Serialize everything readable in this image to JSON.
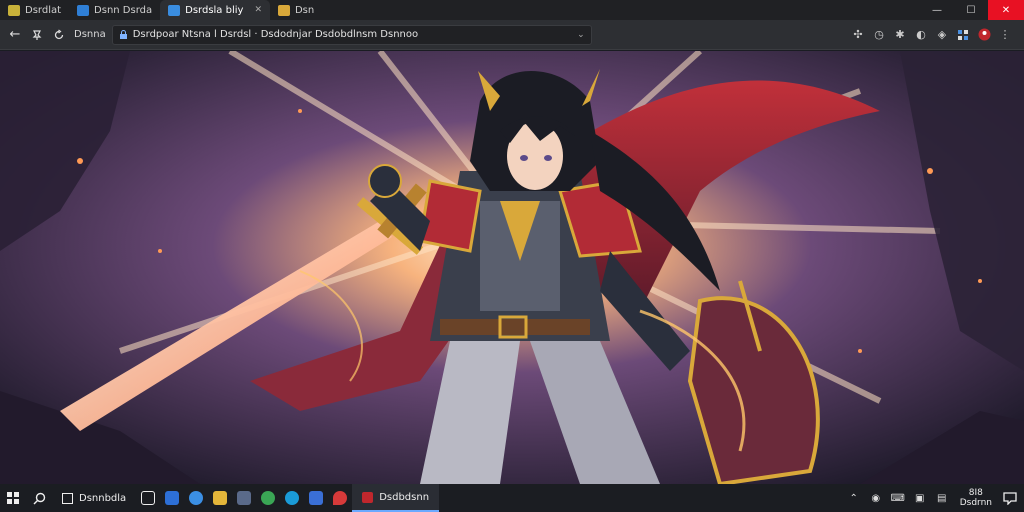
{
  "browser": {
    "tabs": [
      {
        "label": "Dsrdlat",
        "icon": "folder-icon",
        "color": "#c9b23a",
        "active": false
      },
      {
        "label": "Dsnn Dsrda",
        "icon": "cloud-icon",
        "color": "#2f7fd6",
        "active": false
      },
      {
        "label": "Dsrdsla bliy",
        "icon": "image-icon",
        "color": "#3a8de0",
        "active": true,
        "close": "✕"
      },
      {
        "label": "Dsn",
        "icon": "document-icon",
        "color": "#d9a83a",
        "active": false
      }
    ],
    "window_controls": {
      "minimize": "—",
      "maximize": "☐",
      "close": "✕"
    },
    "toolbar": {
      "back": "←",
      "extension_label": "Dsnna",
      "address": "Dsrdpoar Ntsna l Dsrdsl · Dsdodnjar Dsdobdlnsm Dsnnoo"
    }
  },
  "scene": {
    "description_colors": {
      "accent": "#d63a3a",
      "gold": "#d9a83a",
      "glow": "#ffd9b0"
    }
  },
  "taskbar": {
    "running_app_label": "Dsnnbdla",
    "active_app_label": "Dsdbdsnn",
    "clock_line1": "8I8",
    "clock_line2": "Dsdrnn"
  }
}
